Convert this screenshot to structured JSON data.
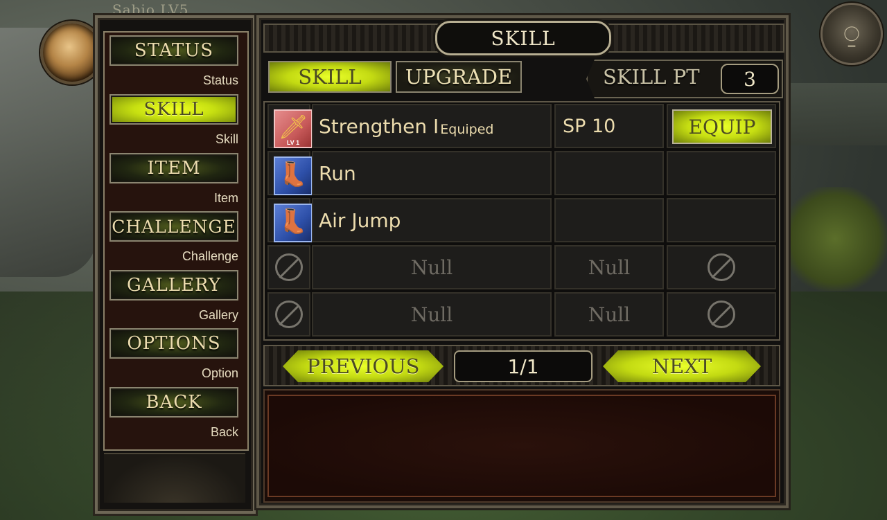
{
  "player": {
    "name_level": "Sabio LV5"
  },
  "menu": {
    "items": [
      {
        "label": "STATUS",
        "sub": "Status",
        "active": false
      },
      {
        "label": "SKILL",
        "sub": "Skill",
        "active": true
      },
      {
        "label": "ITEM",
        "sub": "Item",
        "active": false
      },
      {
        "label": "CHALLENGE",
        "sub": "Challenge",
        "active": false
      },
      {
        "label": "GALLERY",
        "sub": "Gallery",
        "active": false
      },
      {
        "label": "OPTIONS",
        "sub": "Option",
        "active": false
      },
      {
        "label": "BACK",
        "sub": "Back",
        "active": false
      }
    ]
  },
  "panel": {
    "title": "SKILL",
    "tabs": [
      {
        "label": "SKILL",
        "active": true
      },
      {
        "label": "UPGRADE",
        "active": false
      }
    ],
    "skill_pt_label": "SKILL PT",
    "skill_pt_value": "3"
  },
  "skills": [
    {
      "icon": "sword-icon",
      "level_tag": "LV 1",
      "name": "Strengthen I",
      "status": "Equiped",
      "sp": "SP 10",
      "action": "EQUIP"
    },
    {
      "icon": "boot-icon",
      "name": "Run",
      "status": "",
      "sp": "",
      "action": ""
    },
    {
      "icon": "boot-icon",
      "name": "Air Jump",
      "status": "",
      "sp": "",
      "action": ""
    },
    {
      "icon": "null",
      "name": "Null",
      "sp": "Null"
    },
    {
      "icon": "null",
      "name": "Null",
      "sp": "Null"
    }
  ],
  "pager": {
    "previous_label": "PREVIOUS",
    "next_label": "NEXT",
    "page": "1/1"
  },
  "colors": {
    "accent_green": "#c8e014",
    "text_cream": "#ecdcae",
    "panel_dark": "#1e1d1b",
    "description_red": "#2a110b"
  }
}
